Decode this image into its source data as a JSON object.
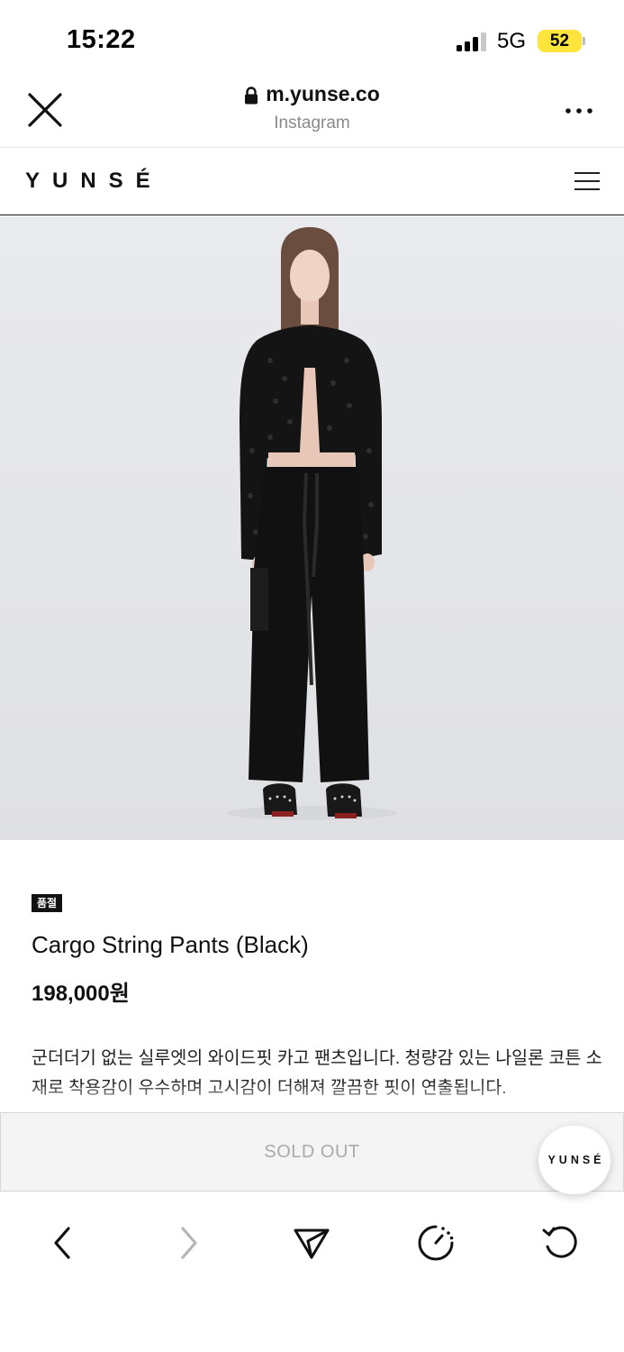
{
  "status_bar": {
    "time": "15:22",
    "network": "5G",
    "battery": "52"
  },
  "browser": {
    "url": "m.yunse.co",
    "source": "Instagram",
    "icons": {
      "close": "close-icon",
      "lock": "lock-icon",
      "more": "more-icon"
    }
  },
  "site": {
    "logo": "YUNSÉ",
    "menu_icon": "hamburger-menu-icon"
  },
  "product": {
    "badge": "품절",
    "name": "Cargo String Pants (Black)",
    "price": "198,000원",
    "description": "군더더기 없는 실루엣의 와이드핏 카고 팬츠입니다. 청량감 있는 나일론 코튼 소재로 착용감이 우수하며 고시감이 더해져 깔끔한 핏이 연출됩니다."
  },
  "purchase": {
    "sold_out_label": "SOLD OUT",
    "floating_logo": "YUNSÉ"
  },
  "toolbar": {
    "icons": [
      "back-icon",
      "forward-icon",
      "share-icon",
      "history-icon",
      "reload-icon"
    ]
  },
  "colors": {
    "battery": "#ffe43b",
    "badge_bg": "#111111",
    "sold_out_text": "#aaaaaa",
    "photo_bg": "#e6e7eb"
  }
}
